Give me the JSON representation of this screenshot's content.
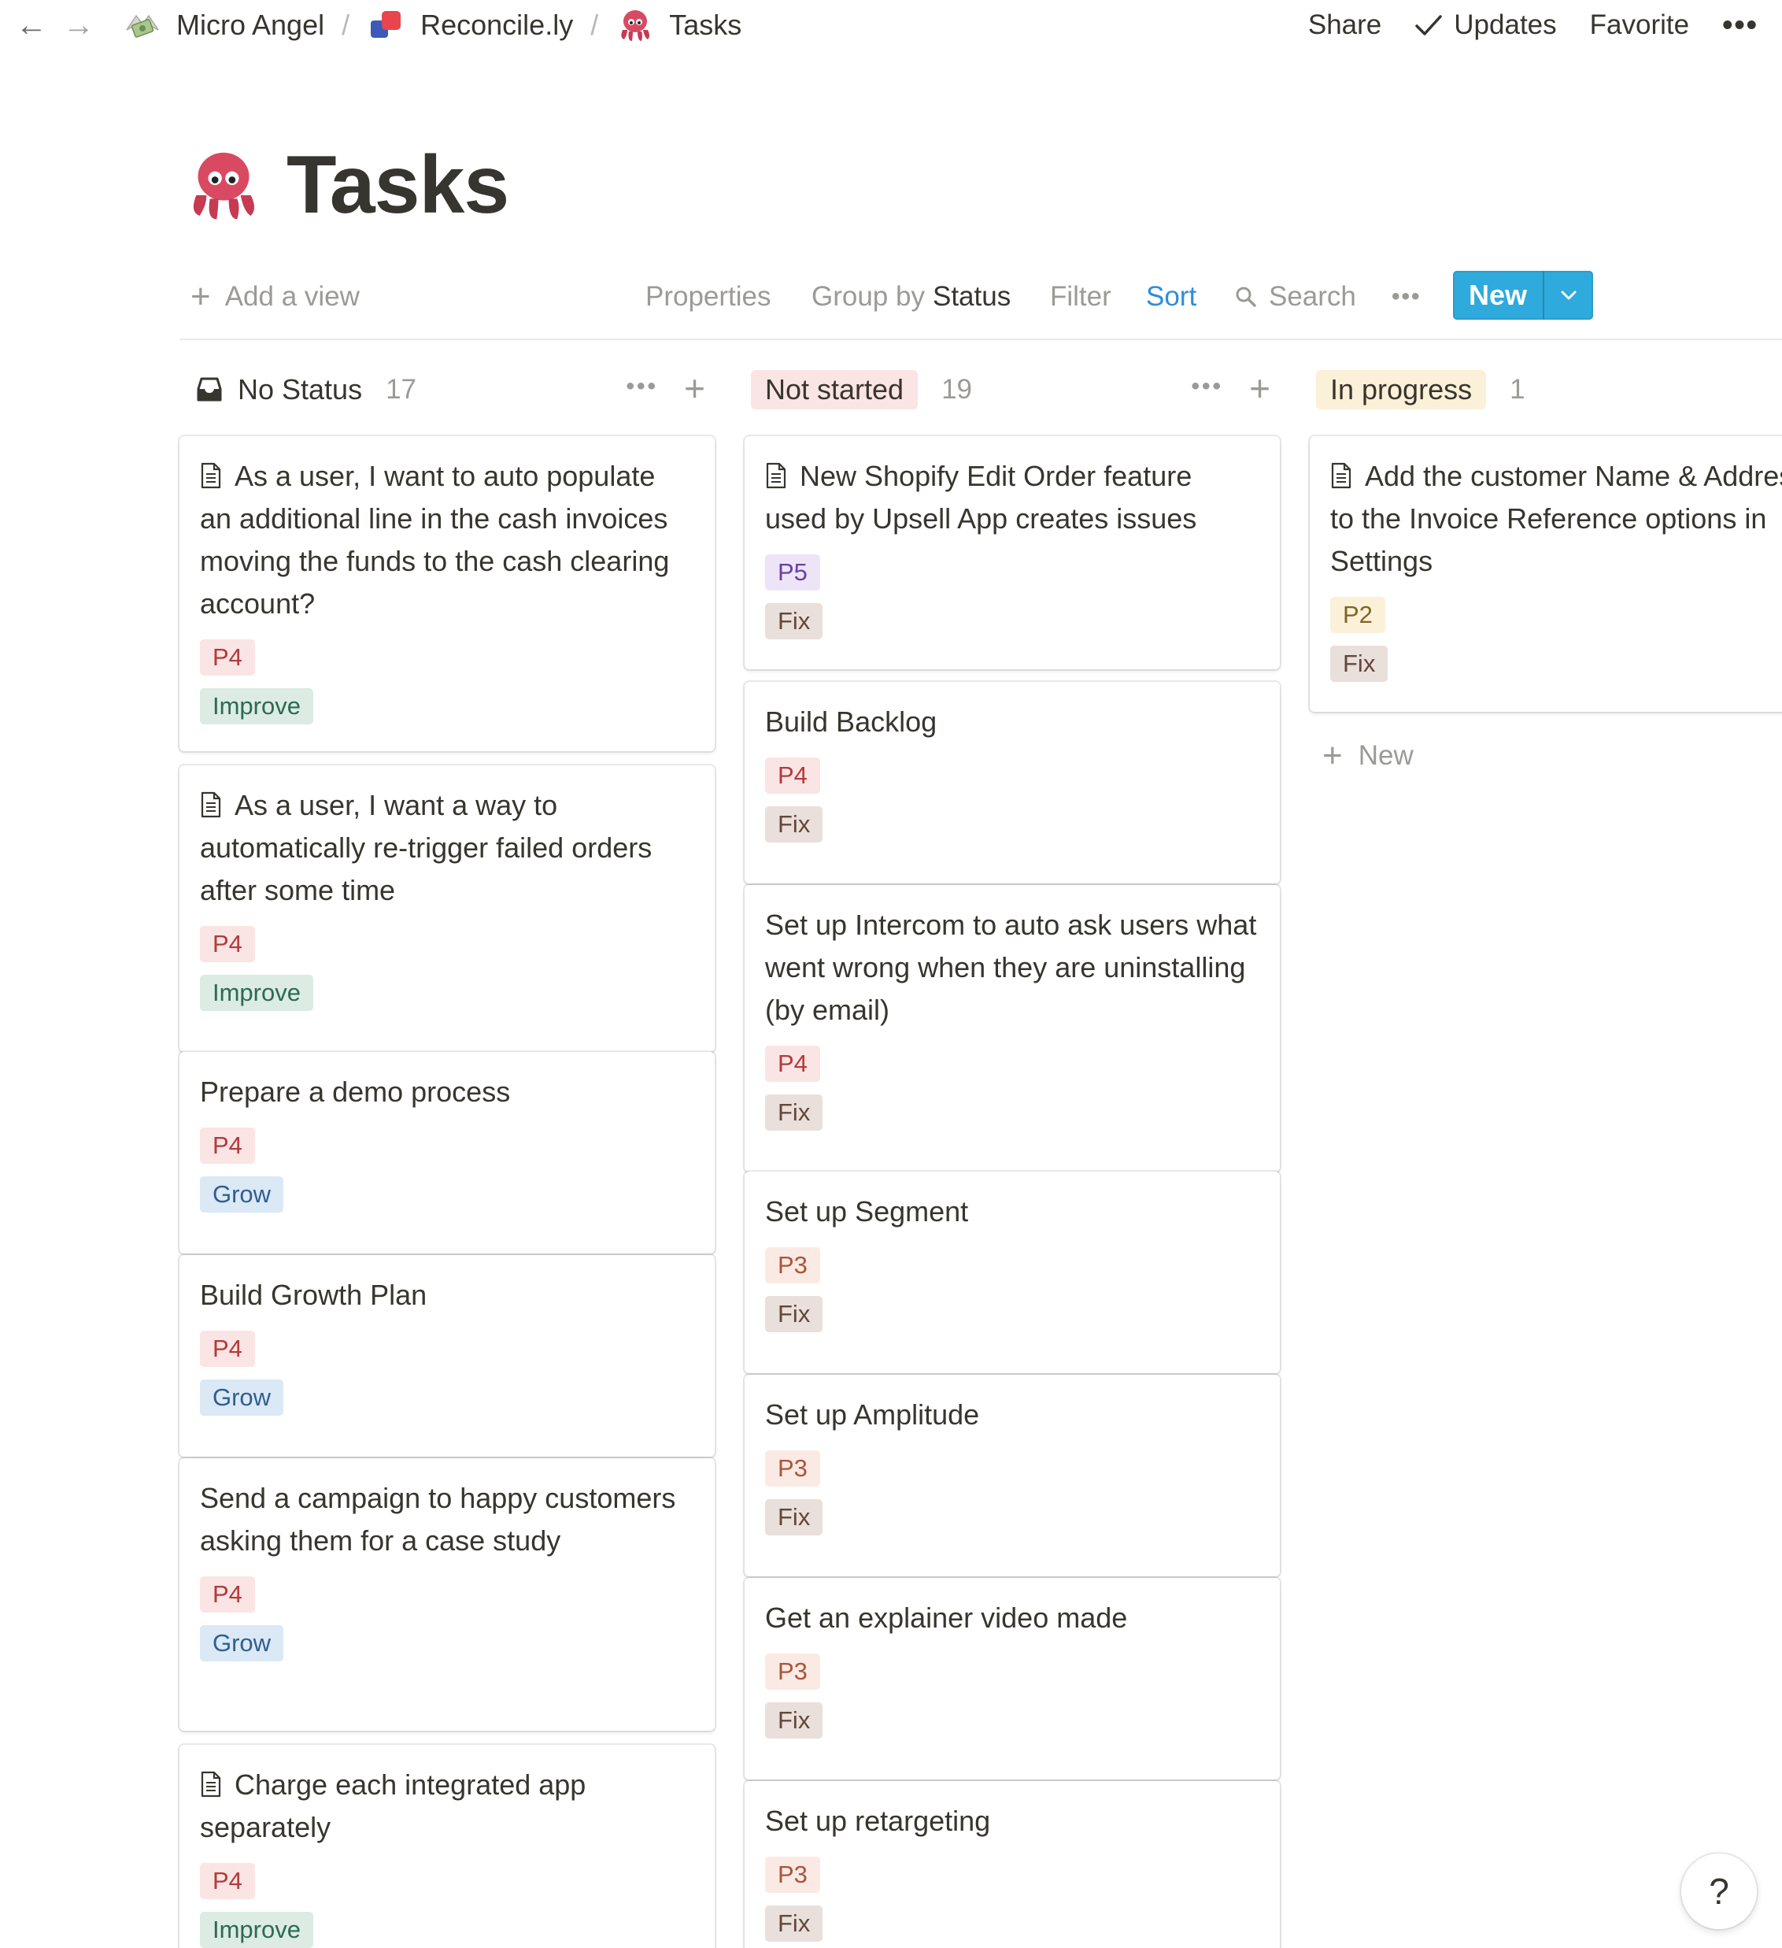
{
  "breadcrumb": {
    "items": [
      {
        "label": "Micro Angel",
        "icon": "money-wings-icon"
      },
      {
        "label": "Reconcile.ly",
        "icon": "shapes-logo-icon"
      },
      {
        "label": "Tasks",
        "icon": "octopus-icon"
      }
    ],
    "separator": "/"
  },
  "topbar": {
    "share": "Share",
    "updates": "Updates",
    "favorite": "Favorite",
    "more": "•••"
  },
  "page": {
    "title": "Tasks",
    "icon": "octopus-icon"
  },
  "toolbar": {
    "add_view": "Add a view",
    "properties": "Properties",
    "group_by_prefix": "Group by",
    "group_by_value": "Status",
    "filter": "Filter",
    "sort": "Sort",
    "search": "Search",
    "more": "•••",
    "new": "New"
  },
  "colors": {
    "p4_bg": "#fbe4e4",
    "p4_fg": "#b33a3a",
    "p5_bg": "#ede5f7",
    "p5_fg": "#6940a5",
    "p3_bg": "#fbeae4",
    "p3_fg": "#a8563b",
    "p2_bg": "#fbf0d8",
    "p2_fg": "#7f6524",
    "improve_bg": "#dcebe4",
    "improve_fg": "#2b6b4f",
    "grow_bg": "#dbe8f6",
    "grow_fg": "#2f5f8e",
    "fix_bg": "#e9dfdb",
    "fix_fg": "#64473a",
    "not_started_bg": "#fbe4e4",
    "in_progress_bg": "#fbf0d8",
    "accent": "#2eaadc"
  },
  "board": {
    "columns": [
      {
        "name": "No Status",
        "count": "17",
        "more": "•••",
        "cards": [
          {
            "title": "As a user, I want to auto populate an additional line in the cash invoices moving the funds to the cash clearing account?",
            "has_doc": true,
            "priority": "P4",
            "category": "Improve"
          },
          {
            "title": "As a user, I want a way to automatically re-trigger failed orders after some time",
            "has_doc": true,
            "priority": "P4",
            "category": "Improve"
          },
          {
            "title": "Prepare a demo process",
            "has_doc": false,
            "priority": "P4",
            "category": "Grow"
          },
          {
            "title": "Build Growth Plan",
            "has_doc": false,
            "priority": "P4",
            "category": "Grow"
          },
          {
            "title": "Send a campaign to happy customers asking them for a case study",
            "has_doc": false,
            "priority": "P4",
            "category": "Grow"
          },
          {
            "title": "Charge each integrated app separately",
            "has_doc": true,
            "priority": "P4",
            "category": "Improve"
          }
        ]
      },
      {
        "name": "Not started",
        "count": "19",
        "more": "•••",
        "cards": [
          {
            "title": "New Shopify Edit Order feature used by Upsell App creates issues",
            "has_doc": true,
            "priority": "P5",
            "category": "Fix"
          },
          {
            "title": "Build Backlog",
            "has_doc": false,
            "priority": "P4",
            "category": "Fix"
          },
          {
            "title": "Set up Intercom to auto ask users what went wrong when they are uninstalling (by email)",
            "has_doc": false,
            "priority": "P4",
            "category": "Fix"
          },
          {
            "title": "Set up Segment",
            "has_doc": false,
            "priority": "P3",
            "category": "Fix"
          },
          {
            "title": "Set up Amplitude",
            "has_doc": false,
            "priority": "P3",
            "category": "Fix"
          },
          {
            "title": "Get an explainer video made",
            "has_doc": false,
            "priority": "P3",
            "category": "Fix"
          },
          {
            "title": "Set up retargeting",
            "has_doc": false,
            "priority": "P3",
            "category": "Fix"
          }
        ]
      },
      {
        "name": "In progress",
        "count": "1",
        "more": "•••",
        "cards": [
          {
            "title": "Add the customer Name & Address to the Invoice Reference options in Settings",
            "has_doc": true,
            "priority": "P2",
            "category": "Fix"
          }
        ],
        "add_new": "New"
      }
    ]
  },
  "help": {
    "label": "?"
  }
}
